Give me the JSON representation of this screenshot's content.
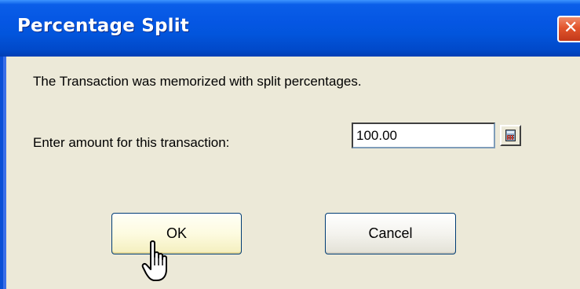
{
  "window": {
    "title": "Percentage Split",
    "close_glyph": "✕"
  },
  "dialog": {
    "message": "The Transaction was memorized with split percentages.",
    "amount_label": "Enter amount for this transaction:",
    "amount_value": "100.00",
    "calculator_icon": "calculator-icon",
    "ok_label": "OK",
    "cancel_label": "Cancel"
  },
  "colors": {
    "titlebar": "#0556e3",
    "dialog_background": "#ece9d8",
    "close_button": "#e2552c",
    "ok_button_highlight": "#fdfbe0"
  },
  "cursor": "hand-pointer-icon"
}
